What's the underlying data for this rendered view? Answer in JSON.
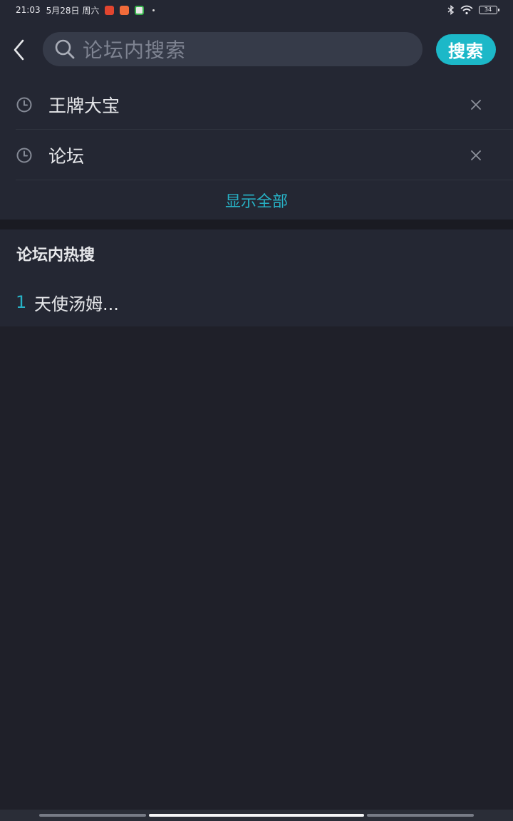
{
  "status_bar": {
    "time": "21:03",
    "date": "5月28日 周六",
    "battery": "34",
    "icons": [
      "app-icon-red",
      "app-icon-orange",
      "app-icon-green",
      "bluetooth-icon",
      "wifi-icon",
      "battery-icon"
    ]
  },
  "header": {
    "back_icon": "chevron-left-icon",
    "search_placeholder": "论坛内搜索",
    "search_button": "搜索"
  },
  "history": {
    "items": [
      {
        "text": "王牌大宝"
      },
      {
        "text": "论坛"
      }
    ],
    "show_all": "显示全部"
  },
  "hot_search": {
    "title": "论坛内热搜",
    "items": [
      {
        "rank": "1",
        "text": "天使汤姆..."
      }
    ]
  },
  "colors": {
    "background": "#1f2029",
    "panel": "#242733",
    "accent": "#1cb8c8",
    "search_field": "#363b49"
  }
}
